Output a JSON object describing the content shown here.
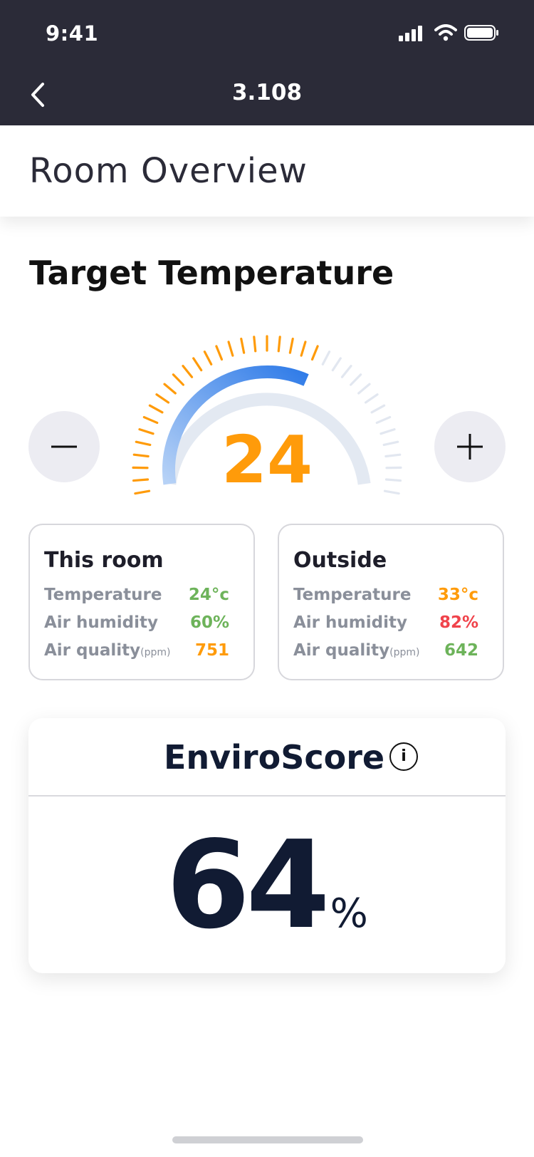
{
  "status_bar": {
    "time": "9:41"
  },
  "nav": {
    "title": "3.108"
  },
  "section": {
    "title": "Room Overview"
  },
  "target": {
    "title": "Target Temperature",
    "value": "24",
    "level_fraction": 0.62,
    "accent_color": "#ff9b0a",
    "active_color": "#2f7be8"
  },
  "this_room": {
    "title": "This room",
    "rows": [
      {
        "label": "Temperature",
        "unit": "",
        "value": "24°c",
        "color": "#6db35a"
      },
      {
        "label": "Air humidity",
        "unit": "",
        "value": "60%",
        "color": "#6db35a"
      },
      {
        "label": "Air quality",
        "unit": "(ppm)",
        "value": "751",
        "color": "#ff9b0a"
      }
    ]
  },
  "outside": {
    "title": "Outside",
    "rows": [
      {
        "label": "Temperature",
        "unit": "",
        "value": "33°c",
        "color": "#ff9b0a"
      },
      {
        "label": "Air humidity",
        "unit": "",
        "value": "82%",
        "color": "#f0434b"
      },
      {
        "label": "Air quality",
        "unit": "(ppm)",
        "value": "642",
        "color": "#6db35a"
      }
    ]
  },
  "enviroscore": {
    "title": "EnviroScore",
    "value": "64",
    "unit": "%",
    "info_icon": "info-icon"
  },
  "icons": {
    "back": "chevron-left-icon",
    "signal": "signal-icon",
    "wifi": "wifi-icon",
    "battery": "battery-icon",
    "minus": "minus-icon",
    "plus": "plus-icon"
  }
}
